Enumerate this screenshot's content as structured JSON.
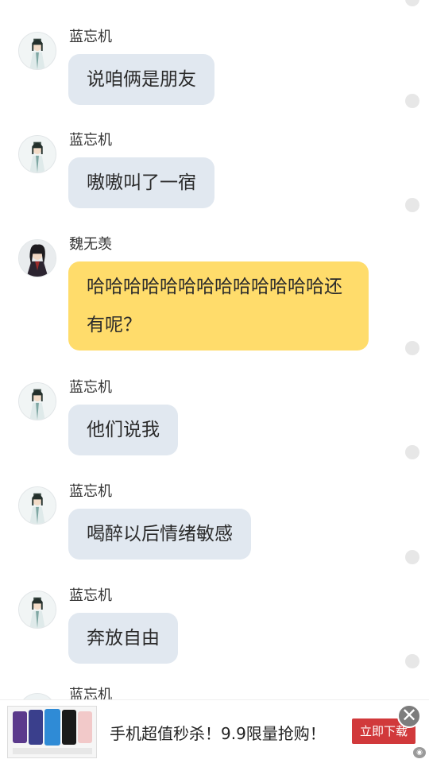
{
  "messages": [
    {
      "sender": "蓝忘机",
      "text": "说咱俩是朋友",
      "avatar": "lanwangji-avatar"
    },
    {
      "sender": "蓝忘机",
      "text": "嗷嗷叫了一宿",
      "avatar": "lanwangji-avatar"
    },
    {
      "sender": "魏无羡",
      "text": "哈哈哈哈哈哈哈哈哈哈哈哈哈还有呢？",
      "avatar": "weiwuxian-avatar"
    },
    {
      "sender": "蓝忘机",
      "text": "他们说我",
      "avatar": "lanwangji-avatar"
    },
    {
      "sender": "蓝忘机",
      "text": "喝醉以后情绪敏感",
      "avatar": "lanwangji-avatar"
    },
    {
      "sender": "蓝忘机",
      "text": "奔放自由",
      "avatar": "lanwangji-avatar"
    }
  ],
  "partial_next": {
    "sender": "蓝忘机"
  },
  "ad": {
    "text": "手机超值秒杀！9.9限量抢购！",
    "button_label": "立即下载",
    "close_glyph": "✕",
    "mark_glyph": "◉"
  },
  "colors": {
    "bubble_blue": "#e1e8f0",
    "bubble_yellow": "#ffdc6b",
    "ad_button": "#d1393b"
  }
}
